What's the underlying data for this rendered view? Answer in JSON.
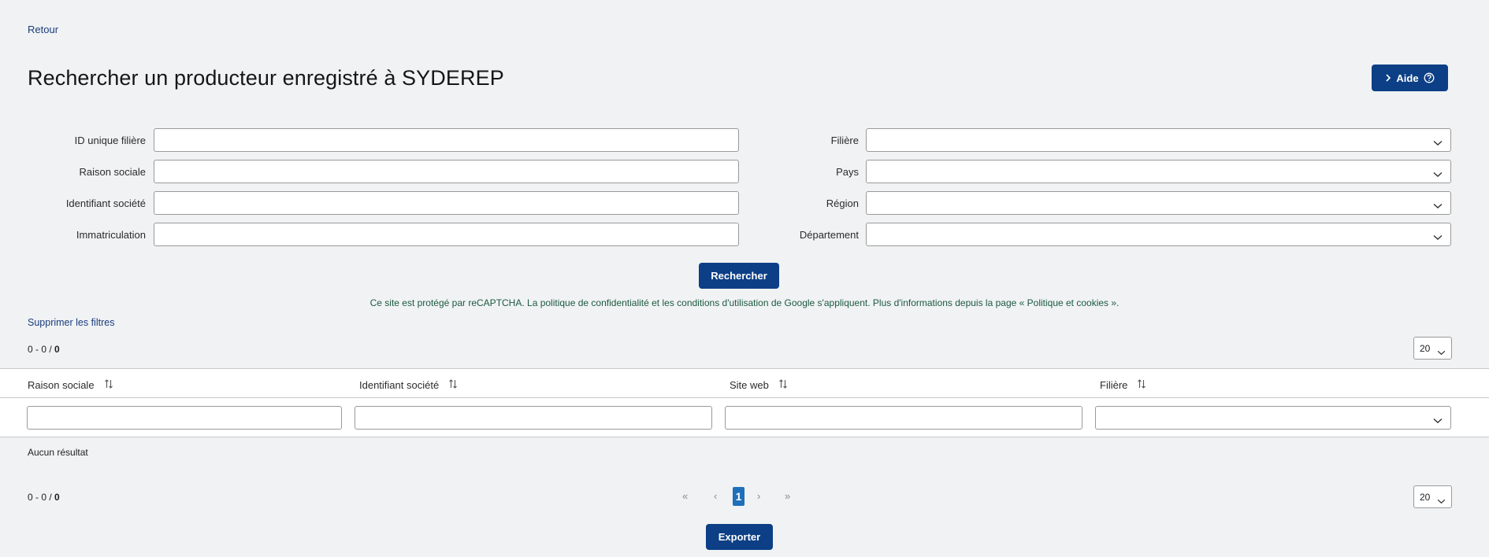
{
  "nav": {
    "back_label": "Retour"
  },
  "header": {
    "title": "Rechercher un producteur enregistré à SYDEREP",
    "help_label": "Aide"
  },
  "filters": {
    "left": [
      {
        "label": "ID unique filière",
        "value": ""
      },
      {
        "label": "Raison sociale",
        "value": ""
      },
      {
        "label": "Identifiant société",
        "value": ""
      },
      {
        "label": "Immatriculation",
        "value": ""
      }
    ],
    "right": [
      {
        "label": "Filière",
        "value": ""
      },
      {
        "label": "Pays",
        "value": ""
      },
      {
        "label": "Région",
        "value": ""
      },
      {
        "label": "Département",
        "value": ""
      }
    ],
    "search_label": "Rechercher",
    "recaptcha_notice": "Ce site est protégé par reCAPTCHA. La politique de confidentialité et les conditions d'utilisation de Google s'appliquent. Plus d'informations depuis la page « Politique et cookies ».",
    "clear_label": "Supprimer les filtres"
  },
  "results": {
    "count_range": "0 - 0 / ",
    "count_total": "0",
    "page_size": "20",
    "columns": [
      {
        "label": "Raison sociale"
      },
      {
        "label": "Identifiant société"
      },
      {
        "label": "Site web"
      },
      {
        "label": "Filière"
      }
    ],
    "empty_text": "Aucun résultat"
  },
  "pagination": {
    "first": "«",
    "prev": "‹",
    "current_page": "1",
    "next": "›",
    "last": "»",
    "count_range": "0 - 0 / ",
    "count_total": "0",
    "page_size": "20"
  },
  "export": {
    "label": "Exporter"
  },
  "colors": {
    "primary": "#0d3f86",
    "link": "#1a3d7c",
    "page_bg": "#f0f2f4",
    "active_page": "#1f6fb9"
  }
}
